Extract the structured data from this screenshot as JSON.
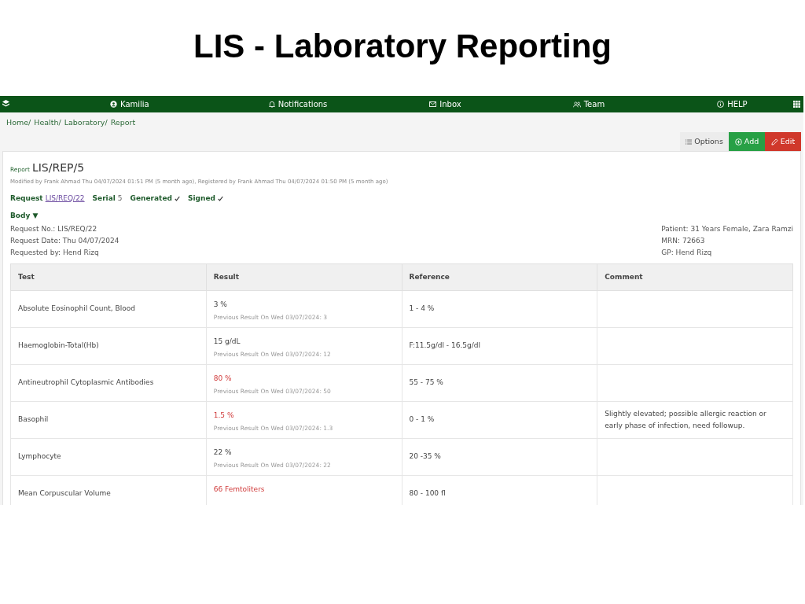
{
  "slide_title": "LIS - Laboratory Reporting",
  "nav": {
    "items": [
      {
        "kind": "user",
        "label": "Kamilia"
      },
      {
        "kind": "bell",
        "label": "Notifications"
      },
      {
        "kind": "mail",
        "label": "Inbox"
      },
      {
        "kind": "team",
        "label": "Team"
      },
      {
        "kind": "info",
        "label": "HELP"
      }
    ]
  },
  "breadcrumb": [
    "Home/",
    "Health/",
    "Laboratory/",
    "Report"
  ],
  "toolbar": [
    {
      "kind": "options",
      "label": "Options"
    },
    {
      "kind": "add",
      "label": "Add"
    },
    {
      "kind": "edit",
      "label": "Edit"
    }
  ],
  "report": {
    "label": "Report",
    "number": "LIS/REP/5",
    "meta": "Modified by Frank Ahmad Thu 04/07/2024 01:51 PM (5 month ago), Registered by Frank Ahmad Thu 04/07/2024 01:50 PM (5 month ago)",
    "request_label": "Request",
    "request_link": "LIS/REQ/22",
    "serial_label": "Serial",
    "serial": "5",
    "generated": {
      "label": "Generated",
      "checked": true
    },
    "signed": {
      "label": "Signed",
      "checked": true
    }
  },
  "body": {
    "title": "Body ▼",
    "left": [
      "Request No.: LIS/REQ/22",
      "Request Date: Thu 04/07/2024",
      "Requested by: Hend Rizq"
    ],
    "right": [
      "Patient: 31 Years Female, Zara Ramzi",
      "MRN: 72663",
      "GP: Hend Rizq"
    ]
  },
  "table": {
    "columns": [
      "Test",
      "Result",
      "Reference",
      "Comment"
    ],
    "rows": [
      {
        "test": "Absolute Eosinophil Count, Blood",
        "result": "3 %",
        "abnormal": false,
        "previous": "Previous Result On Wed 03/07/2024: 3",
        "reference": "1 - 4 %"
      },
      {
        "test": "Haemoglobin-Total(Hb)",
        "result": "15 g/dL",
        "abnormal": false,
        "previous": "Previous Result On Wed 03/07/2024: 12",
        "reference": "F:11.5g/dl - 16.5g/dl"
      },
      {
        "test": "Antineutrophil Cytoplasmic Antibodies",
        "result": "80 %",
        "abnormal": true,
        "previous": "Previous Result On Wed 03/07/2024: 50",
        "reference": "55 - 75 %"
      },
      {
        "test": "Basophil",
        "result": "1.5 %",
        "abnormal": true,
        "previous": "Previous Result On Wed 03/07/2024: 1.3",
        "reference": "0 - 1 %",
        "comment": "Slightly elevated; possible allergic reaction or early phase of infection, need followup."
      },
      {
        "test": "Lymphocyte",
        "result": "22 %",
        "abnormal": false,
        "previous": "Previous Result On Wed 03/07/2024: 22",
        "reference": "20 -35 %"
      },
      {
        "test": "Mean Corpuscular Volume",
        "result": "66 Femtoliters",
        "abnormal": true,
        "reference": "80 - 100 fl"
      }
    ]
  }
}
